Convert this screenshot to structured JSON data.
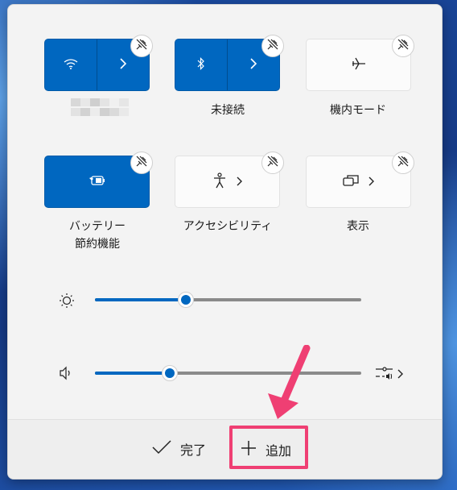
{
  "quick_settings": {
    "tiles": [
      {
        "id": "wifi",
        "label": "",
        "state": "on",
        "split": true,
        "icon": "wifi-icon"
      },
      {
        "id": "bluetooth",
        "label": "未接続",
        "state": "on",
        "split": true,
        "icon": "bluetooth-icon"
      },
      {
        "id": "airplane",
        "label": "機内モード",
        "state": "off",
        "split": false,
        "icon": "airplane-icon"
      },
      {
        "id": "battery-saver",
        "label_line1": "バッテリー",
        "label_line2": "節約機能",
        "state": "on",
        "split": false,
        "icon": "battery-saver-icon"
      },
      {
        "id": "accessibility",
        "label": "アクセシビリティ",
        "state": "off",
        "split": false,
        "has_chevron": true,
        "icon": "accessibility-icon"
      },
      {
        "id": "display",
        "label": "表示",
        "state": "off",
        "split": false,
        "has_chevron": true,
        "icon": "cast-display-icon"
      }
    ],
    "brightness": {
      "value_fraction": 0.34,
      "icon": "brightness-icon"
    },
    "volume": {
      "value_fraction": 0.28,
      "icon": "speaker-icon",
      "mixer_icon": "volume-mixer-icon"
    },
    "footer": {
      "done_label": "完了",
      "add_label": "追加"
    },
    "accent_color": "#0067c0",
    "annotation_color": "#ef3f73"
  }
}
